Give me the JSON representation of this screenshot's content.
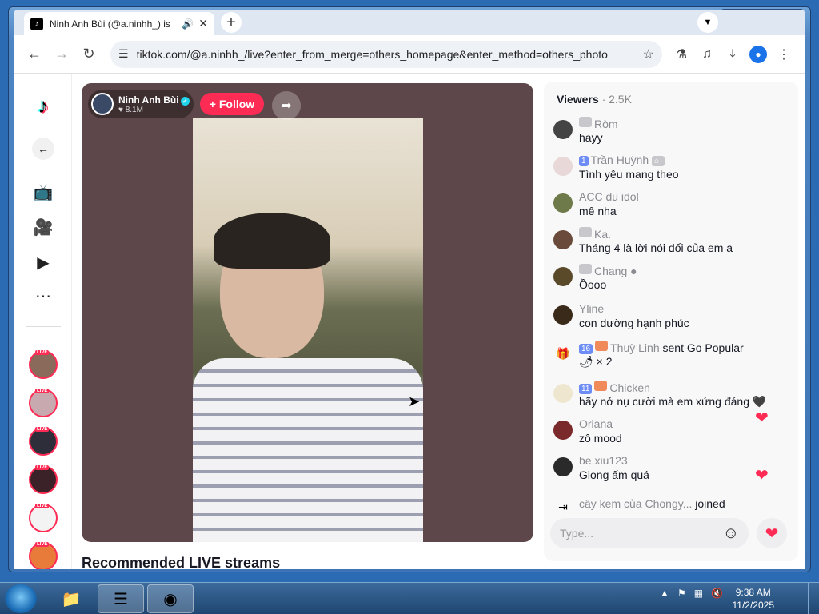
{
  "browser": {
    "tab_title": "Ninh Anh Bùi (@a.ninhh_) is",
    "tab_icon": "tiktok-icon",
    "new_tab_label": "+",
    "url": "tiktok.com/@a.ninhh_/live?enter_from_merge=others_homepage&enter_method=others_photo"
  },
  "stream": {
    "host_name": "Ninh Anh Bùi",
    "host_likes": "8.1M",
    "follow_label": "+ Follow",
    "recommended_title": "Recommended LIVE streams"
  },
  "chat": {
    "viewers_label": "Viewers",
    "viewers_count": "· 2.5K",
    "input_placeholder": "Type...",
    "messages": [
      {
        "badge": "",
        "user": "Ròm",
        "text": "hayy"
      },
      {
        "badge": "1",
        "user": "Trần Huỳnh",
        "text": "Tình yêu mang theo"
      },
      {
        "badge": "",
        "user": "ACC du idol",
        "text": "mê nha"
      },
      {
        "badge": "",
        "user": "Ka.",
        "text": "Tháng 4 là lời nói dối của em ạ"
      },
      {
        "badge": "",
        "user": "Chang",
        "text": "Ồooo"
      },
      {
        "badge": "",
        "user": "Yline",
        "text": "con dường hạnh phúc"
      },
      {
        "badge": "16",
        "user": "Thuỳ Linh",
        "action": "sent Go Popular",
        "text": "× 2"
      },
      {
        "badge": "11",
        "user": "Chicken",
        "text": "hãy nở nụ cười mà em xứng đáng 🖤"
      },
      {
        "badge": "",
        "user": "Oriana",
        "text": "zô mood"
      },
      {
        "badge": "",
        "user": "be.xiu123",
        "text": "Giọng ấm quá"
      }
    ],
    "joined": {
      "user": "cây kem của Chongy...",
      "text": "joined"
    }
  },
  "taskbar": {
    "time": "9:38 AM",
    "date": "11/2/2025"
  }
}
